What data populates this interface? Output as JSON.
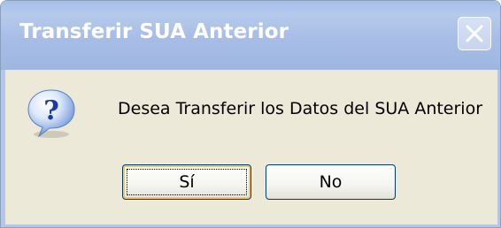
{
  "dialog": {
    "title": "Transferir SUA Anterior",
    "message": "Desea Transferir los Datos del SUA Anterior",
    "icon": "question-icon",
    "buttons": {
      "yes_label": "Sí",
      "no_label": "No"
    }
  },
  "colors": {
    "titlebar": "#a6bfe8",
    "body": "#ece9d8",
    "button_border": "#003c74",
    "focus_highlight": "#f6c76a"
  }
}
